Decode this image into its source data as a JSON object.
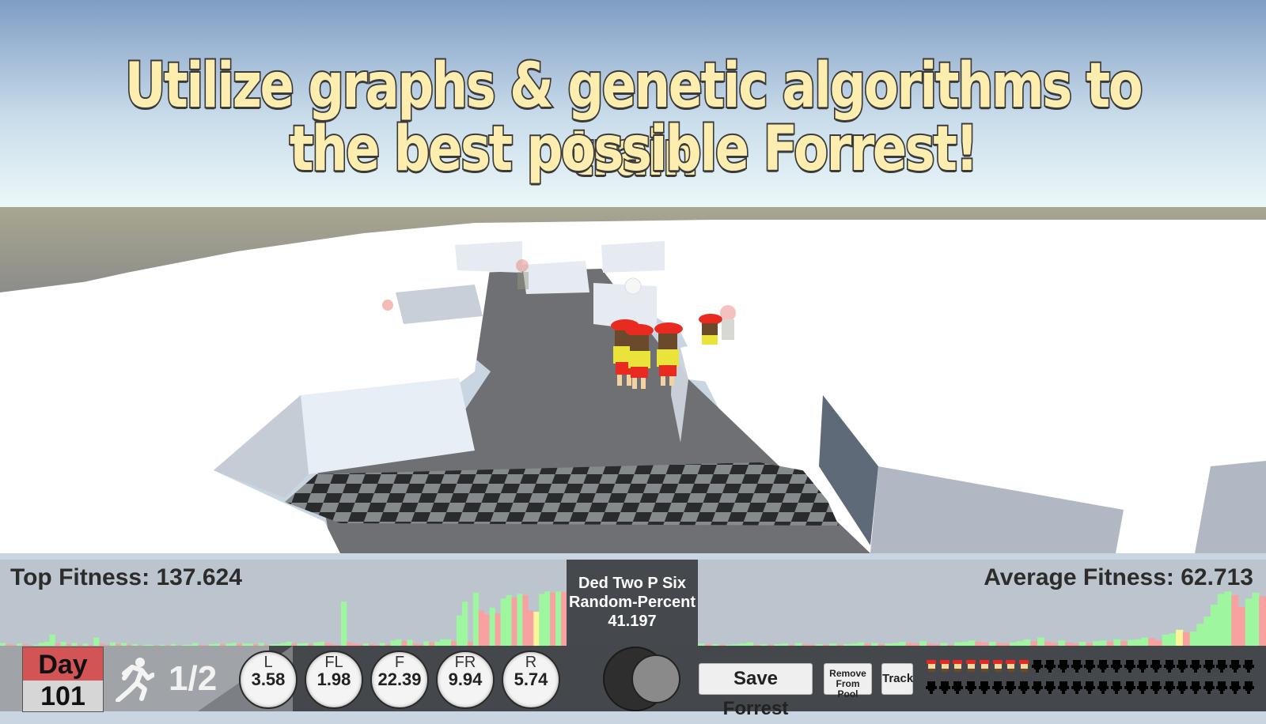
{
  "headline": {
    "line1": "Utilize graphs & genetic algorithms to train",
    "line2": "the best possible Forrest!"
  },
  "scene": {
    "description": "3D maze of white blocks with grey floor, checkered finish strip, runners in red caps and yellow shirts",
    "colors": {
      "sky_top": "#7f9dc4",
      "sky_horizon": "#e8f6f8",
      "ground": "#8f8f8f",
      "walls": "#ffffff",
      "floor": "#6e7073",
      "check_dark": "#2a2b2c",
      "check_light": "#858a8c"
    },
    "runners_visible": 4,
    "ghost_runners_visible": 4
  },
  "stats": {
    "top_fitness": "Top Fitness: 137.624",
    "average_fitness": "Average Fitness: 62.713"
  },
  "selected": {
    "name": "Ded Two P Six",
    "method": "Random-Percent",
    "fitness": "41.197"
  },
  "day": {
    "label": "Day",
    "value": "101"
  },
  "speed": {
    "icon": "runner-icon",
    "label": "1/2"
  },
  "sensors": [
    {
      "name": "L",
      "value": "3.58"
    },
    {
      "name": "FL",
      "value": "1.98"
    },
    {
      "name": "F",
      "value": "22.39"
    },
    {
      "name": "FR",
      "value": "9.94"
    },
    {
      "name": "R",
      "value": "5.74"
    }
  ],
  "toggle": {
    "state": "on"
  },
  "buttons": {
    "save": "Save Forrest",
    "remove": "Remove From Pool",
    "track": "Track"
  },
  "pool": {
    "alive": 8,
    "total": 50,
    "alive_color": "#e8281e",
    "dead_color": "#000000"
  },
  "chart_data": {
    "type": "bar",
    "title": "",
    "series_legend": {
      "improved": "#9ef79e",
      "declined": "#f9a0a0",
      "current": "#fdf59a"
    },
    "ylim": [
      0,
      140
    ],
    "values": [
      6,
      4,
      3,
      5,
      4,
      2,
      3,
      6,
      8,
      20,
      5,
      8,
      4,
      6,
      3,
      5,
      3,
      15,
      5,
      3,
      7,
      4,
      6,
      3,
      4,
      2,
      3,
      3,
      2,
      3,
      2,
      4,
      2,
      3,
      3,
      6,
      3,
      2,
      4,
      5,
      4,
      5,
      6,
      5,
      5,
      5,
      4,
      6,
      3,
      4,
      4,
      6,
      8,
      5,
      5,
      6,
      4,
      7,
      8,
      6,
      4,
      3,
      75,
      7,
      5,
      4,
      5,
      4,
      3,
      6,
      4,
      10,
      12,
      9,
      11,
      5,
      4,
      9,
      7,
      8,
      12,
      12,
      9,
      52,
      75,
      8,
      90,
      60,
      54,
      65,
      55,
      80,
      86,
      82,
      88,
      86,
      60,
      58,
      88,
      92,
      90,
      92,
      91,
      5,
      4,
      4,
      3,
      3,
      4,
      5,
      7,
      3,
      4,
      3,
      4,
      5,
      3,
      6,
      4,
      3,
      4,
      3,
      5,
      3,
      4,
      5,
      7,
      5,
      6,
      4,
      5,
      6,
      8,
      6,
      5,
      9,
      5,
      4,
      6,
      3,
      7,
      8,
      10,
      8,
      7,
      8,
      6,
      5,
      7,
      9,
      12,
      9,
      15,
      8,
      6,
      10,
      7,
      5,
      8,
      6,
      9,
      10,
      8,
      12,
      9,
      11,
      12,
      15,
      14,
      10,
      20,
      22,
      28,
      24,
      25,
      38,
      50,
      70,
      88,
      92,
      86,
      66,
      80,
      90,
      84
    ],
    "colors_pattern": "green = up vs previous day, red = down, yellow = current"
  }
}
